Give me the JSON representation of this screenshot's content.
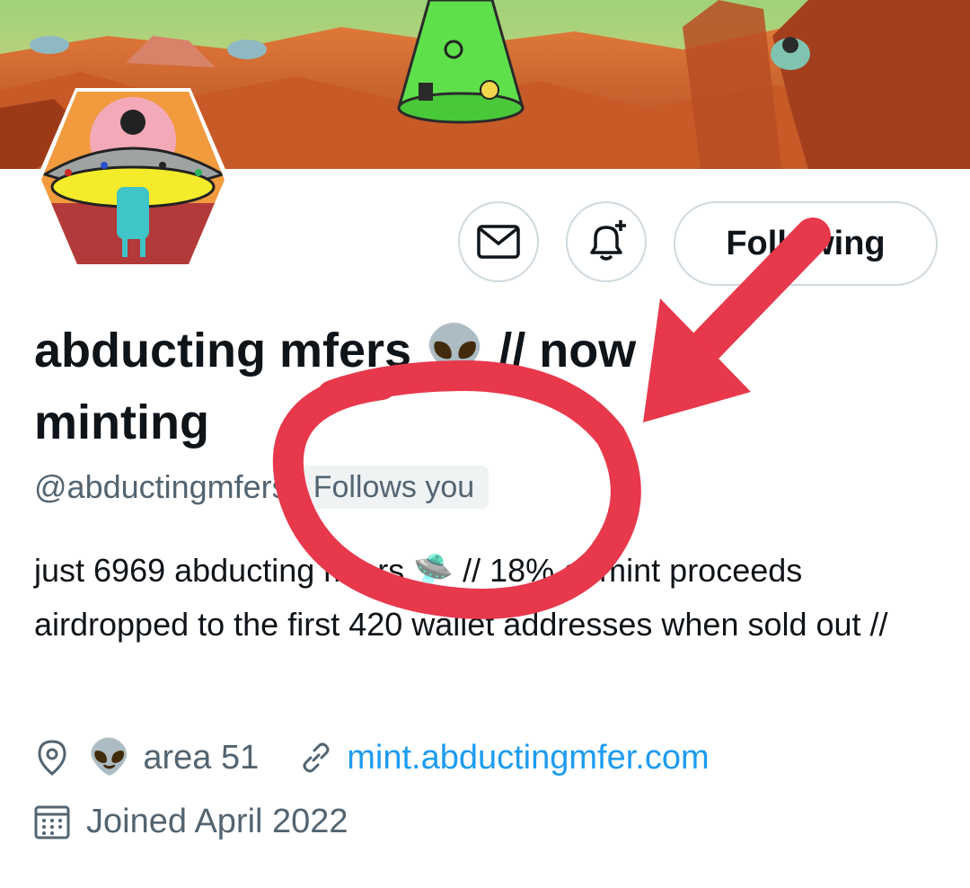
{
  "profile": {
    "display_name": "abducting mfers 👽 // now minting",
    "handle": "@abductingmfers",
    "follows_you_badge": "Follows you",
    "bio": "just 6969 abducting mfers 🛸 // 18% of mint proceeds airdropped to the first 420 wallet addresses when sold out //",
    "location_emoji": "👽",
    "location": "area 51",
    "website": "mint.abductingmfer.com",
    "joined": "Joined April 2022"
  },
  "actions": {
    "following_label": "Following",
    "message_icon": "envelope-icon",
    "notify_icon": "bell-plus-icon"
  },
  "annotation": {
    "color": "#e8384b"
  }
}
